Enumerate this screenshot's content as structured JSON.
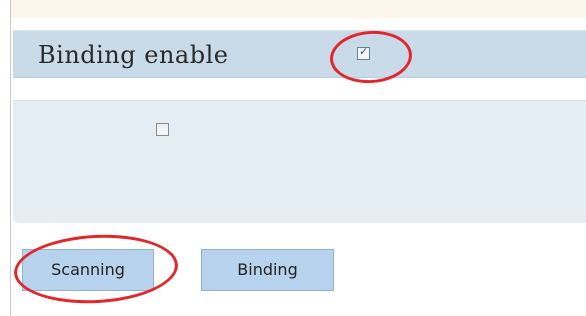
{
  "header": {
    "title": "Binding enable",
    "binding_enable_checked": true
  },
  "panel": {
    "option_checked": false
  },
  "actions": {
    "scanning_label": "Scanning",
    "binding_label": "Binding"
  },
  "annotations": {
    "color": "#e3262a",
    "shape": "red ellipse"
  },
  "theme": {
    "title_bar_bg": "#c9dbe9",
    "panel_bg": "#e6eef5",
    "button_bg": "#b7d3ee",
    "top_strip_bg": "#fcf6ea"
  }
}
